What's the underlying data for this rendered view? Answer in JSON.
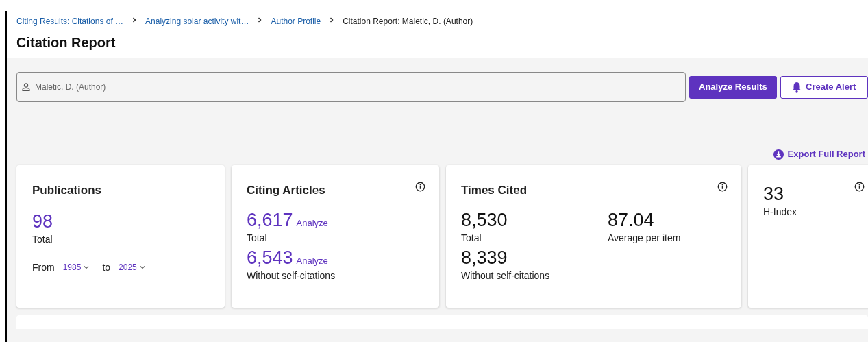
{
  "breadcrumbs": [
    {
      "label": "Citing Results: Citations of …",
      "link": true
    },
    {
      "label": "Analyzing solar activity wit…",
      "link": true
    },
    {
      "label": "Author Profile",
      "link": true
    },
    {
      "label": "Citation Report: Maletic, D. (Author)",
      "link": false
    }
  ],
  "title": "Citation Report",
  "search": {
    "value": "Maletic, D. (Author)"
  },
  "buttons": [
    {
      "label": "Analyze Results",
      "kind": "primary"
    },
    {
      "label": "Create Alert",
      "kind": "outline"
    }
  ],
  "export": {
    "label": "Export Full Report"
  },
  "cards": [
    {
      "kind": "publications",
      "title": "Publications",
      "value": "98",
      "caption": "Total",
      "from_label": "From",
      "from": "1985",
      "to_label": "to",
      "to": "2025"
    },
    {
      "kind": "citing",
      "title": "Citing Articles",
      "info": true,
      "rows": [
        {
          "value": "6,617",
          "link": "Analyze",
          "caption": "Total"
        },
        {
          "value": "6,543",
          "link": "Analyze",
          "caption": "Without self-citations"
        }
      ]
    },
    {
      "kind": "cited",
      "title": "Times Cited",
      "info": true,
      "rows": [
        {
          "value": "8,530",
          "caption": "Total"
        },
        {
          "value": "87.04",
          "caption": "Average per item"
        },
        {
          "value": "8,339",
          "caption": "Without self-citations"
        }
      ]
    },
    {
      "kind": "hindex",
      "info": true,
      "value": "33",
      "caption": "H-Index"
    }
  ]
}
